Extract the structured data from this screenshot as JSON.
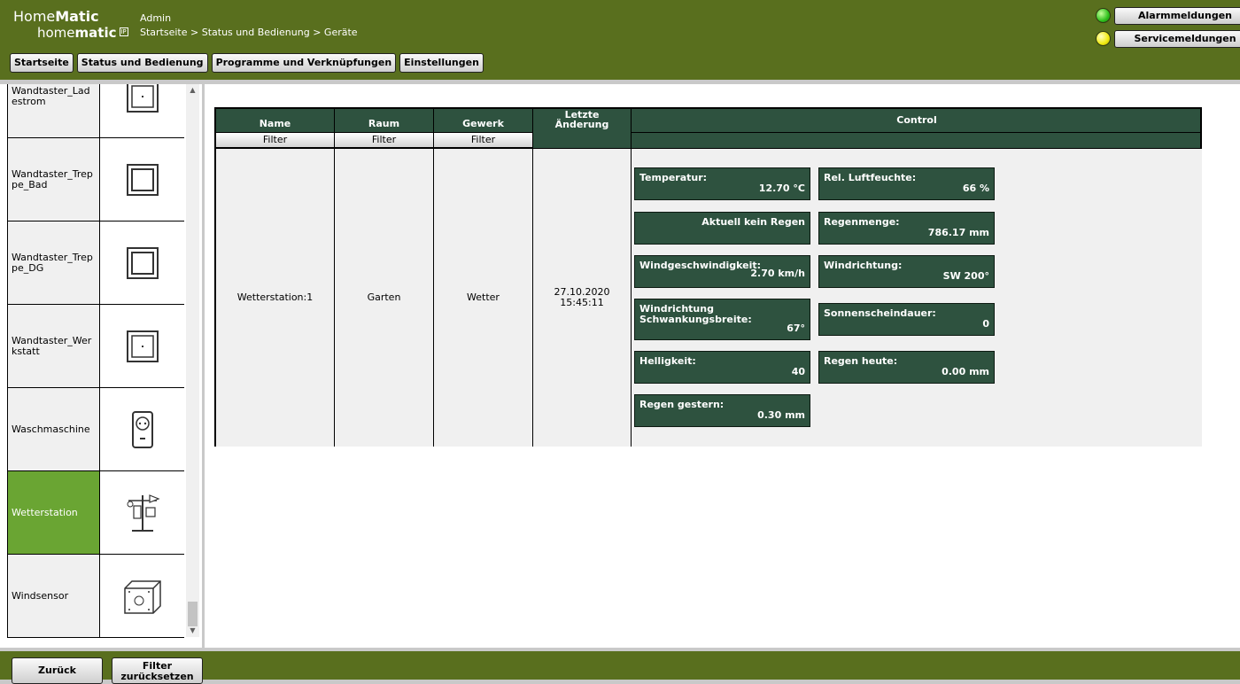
{
  "header": {
    "logo_line1_prefix": "Home",
    "logo_line1_bold": "Matic",
    "logo_line2_prefix": "home",
    "logo_line2_bold": "matic",
    "logo_box": "IP",
    "user": "Admin",
    "breadcrumb": "Startseite > Status und Bedienung > Geräte",
    "nav": [
      "Startseite",
      "Status und Bedienung",
      "Programme und Verknüpfungen",
      "Einstellungen"
    ],
    "alarm_label": "Alarmmeldungen",
    "service_label": "Servicemeldungen",
    "alarm_led_color": "#2ec01c",
    "service_led_color": "#f0ea10"
  },
  "colors": {
    "header_bg": "#596f1e",
    "table_dark": "#2e523f",
    "selected": "#6aa533"
  },
  "sidebar": {
    "devices": [
      {
        "name": "Wandtaster_Ladestrom",
        "icon": "wall-switch-icon"
      },
      {
        "name": "Wandtaster_Treppe_Bad",
        "icon": "wall-switch-icon"
      },
      {
        "name": "Wandtaster_Treppe_DG",
        "icon": "wall-switch-icon"
      },
      {
        "name": "Wandtaster_Werkstatt",
        "icon": "wall-switch-icon"
      },
      {
        "name": "Waschmaschine",
        "icon": "plug-icon"
      },
      {
        "name": "Wetterstation",
        "icon": "weather-station-icon",
        "selected": true
      },
      {
        "name": "Windsensor",
        "icon": "box-sensor-icon"
      }
    ]
  },
  "table": {
    "headers": {
      "name": "Name",
      "room": "Raum",
      "trade": "Gewerk",
      "last_change": "Letzte Änderung",
      "control": "Control"
    },
    "filter_label": "Filter",
    "row": {
      "name": "Wetterstation:1",
      "room": "Garten",
      "trade": "Wetter",
      "date": "27.10.2020",
      "time": "15:45:11"
    },
    "controls": [
      {
        "label": "Temperatur:",
        "value": "12.70 °C"
      },
      {
        "label": "Rel. Luftfeuchte:",
        "value": "66 %"
      },
      {
        "label": "",
        "value": "Aktuell kein Regen"
      },
      {
        "label": "Regenmenge:",
        "value": "786.17 mm"
      },
      {
        "label": "Windgeschwindigkeit:",
        "value": "2.70 km/h"
      },
      {
        "label": "Windrichtung:",
        "value": "SW 200°"
      },
      {
        "label": "Windrichtung Schwankungsbreite:",
        "value": "67°"
      },
      {
        "label": "Sonnenscheindauer:",
        "value": "0"
      },
      {
        "label": "Helligkeit:",
        "value": "40"
      },
      {
        "label": "Regen heute:",
        "value": "0.00 mm"
      },
      {
        "label": "Regen gestern:",
        "value": "0.30 mm"
      }
    ]
  },
  "footer": {
    "back": "Zurück",
    "reset_filter": "Filter zurücksetzen"
  }
}
